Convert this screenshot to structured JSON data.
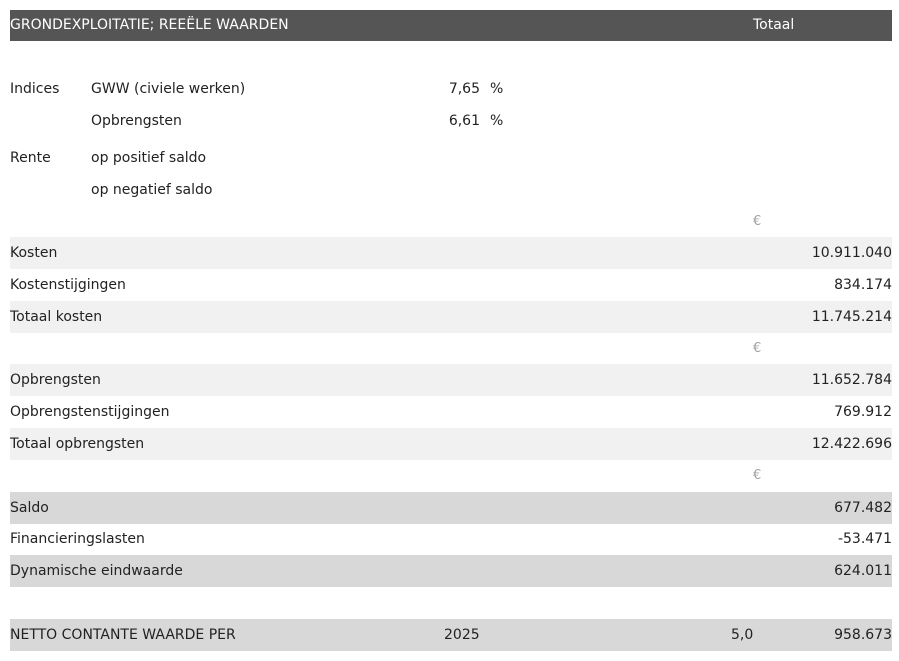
{
  "header": {
    "title": "GRONDEXPLOITATIE; REEËLE WAARDEN",
    "total_label": "Totaal"
  },
  "indices": {
    "label": "Indices",
    "gww_label": "GWW (civiele werken)",
    "gww_value": "7,65",
    "opbrengsten_label": "Opbrengsten",
    "opbrengsten_value": "6,61",
    "unit": "%"
  },
  "rente": {
    "label": "Rente",
    "positief_label": "op positief saldo",
    "negatief_label": "op negatief saldo"
  },
  "currency_symbol": "€",
  "kosten": {
    "kosten_label": "Kosten",
    "kosten_value": "10.911.040",
    "stijgingen_label": "Kostenstijgingen",
    "stijgingen_value": "834.174",
    "totaal_label": "Totaal kosten",
    "totaal_value": "11.745.214"
  },
  "opbrengsten": {
    "opbrengsten_label": "Opbrengsten",
    "opbrengsten_value": "11.652.784",
    "stijgingen_label": "Opbrengstenstijgingen",
    "stijgingen_value": "769.912",
    "totaal_label": "Totaal opbrengsten",
    "totaal_value": "12.422.696"
  },
  "saldo": {
    "saldo_label": "Saldo",
    "saldo_value": "677.482",
    "financiering_label": "Financieringslasten",
    "financiering_value": "-53.471",
    "eindwaarde_label": "Dynamische eindwaarde",
    "eindwaarde_value": "624.011"
  },
  "ncw": {
    "label": "NETTO CONTANTE WAARDE PER",
    "year": "2025",
    "rate": "5,0",
    "value": "958.673"
  }
}
